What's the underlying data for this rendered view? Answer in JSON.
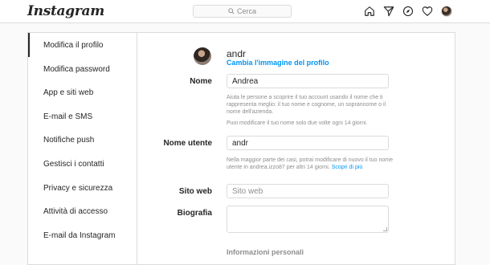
{
  "app": {
    "logo": "Instagram"
  },
  "search": {
    "placeholder": "Cerca"
  },
  "sidebar": {
    "items": [
      {
        "label": "Modifica il profilo",
        "active": true
      },
      {
        "label": "Modifica password"
      },
      {
        "label": "App e siti web"
      },
      {
        "label": "E-mail e SMS"
      },
      {
        "label": "Notifiche push"
      },
      {
        "label": "Gestisci i contatti"
      },
      {
        "label": "Privacy e sicurezza"
      },
      {
        "label": "Attività di accesso"
      },
      {
        "label": "E-mail da Instagram"
      }
    ]
  },
  "profile": {
    "username": "andr",
    "change_photo": "Cambia l'immagine del profilo"
  },
  "form": {
    "name": {
      "label": "Nome",
      "value": "Andrea",
      "help1": "Aiuta le persone a scoprire il tuo account usando il nome che ti rappresenta meglio: il tuo nome e cognome, un soprannome o il nome dell'azienda.",
      "help2": "Puoi modificare il tuo nome solo due volte ogni 14 giorni."
    },
    "username": {
      "label": "Nome utente",
      "value": "andr",
      "help": "Nella maggior parte dei casi, potrai modificare di nuovo il tuo nome utente in andrea.izzo87 per altri 14 giorni.",
      "help_link": "Scopri di più"
    },
    "website": {
      "label": "Sito web",
      "placeholder": "Sito web"
    },
    "bio": {
      "label": "Biografia"
    },
    "personal_info_title": "Informazioni personali"
  }
}
